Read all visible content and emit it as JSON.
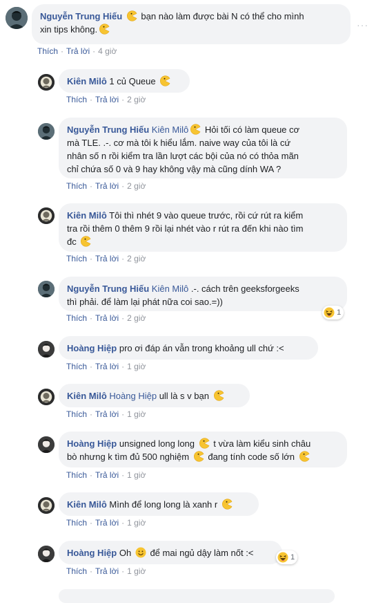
{
  "actions": {
    "like": "Thích",
    "reply": "Trả lời",
    "separator": "·"
  },
  "comments": [
    {
      "author": "Nguyễn Trung Hiếu",
      "text1": "bạn nào làm được bài N có thể cho mình",
      "text2": "xin tips không.",
      "time": "4 giờ",
      "avatar": "nth"
    },
    {
      "author": "Kiên Milô",
      "text": "1 củ Queue",
      "time": "2 giờ",
      "avatar": "km"
    },
    {
      "author": "Nguyễn Trung Hiếu",
      "tag": "Kiên Milô",
      "line1": "Hỏi tối có làm queue cơ",
      "line2": "mà TLE. .-. cơ mà tôi k hiểu lắm. naive way của tôi là cứ",
      "line3": "nhân số n rồi kiểm tra lần lượt các bội của nó có thỏa mãn",
      "line4": "chỉ chứa số 0 và 9 hay không vậy mà cũng dính WA ?",
      "time": "2 giờ",
      "avatar": "nth"
    },
    {
      "author": "Kiên Milô",
      "line1": "Tôi thì nhét 9 vào queue trước, rồi cứ rút ra kiểm",
      "line2": "tra rồi thêm 0 thêm 9 rồi lại nhét vào r rút ra đến khi nào tìm",
      "line3": "đc",
      "time": "2 giờ",
      "avatar": "km"
    },
    {
      "author": "Nguyễn Trung Hiếu",
      "tag": "Kiên Milô",
      "line1": ".-. cách trên geeksforgeeks",
      "line2": "thì phải. để làm lại phát nữa coi sao.=))",
      "time": "2 giờ",
      "reaction_count": "1",
      "avatar": "nth"
    },
    {
      "author": "Hoàng Hiệp",
      "text": "pro ơi đáp án vẫn trong khoảng ull chứ :<",
      "time": "1 giờ",
      "avatar": "hh"
    },
    {
      "author": "Kiên Milô",
      "tag": "Hoàng Hiệp",
      "text": "ull là s v bạn",
      "time": "1 giờ",
      "avatar": "km"
    },
    {
      "author": "Hoàng Hiệp",
      "line1a": "unsigned long long",
      "line1b": "t vừa làm kiểu sinh châu",
      "line2a": "bò nhưng k tìm đủ 500 nghiệm",
      "line2b": "đang tính code số lớn",
      "time": "1 giờ",
      "avatar": "hh"
    },
    {
      "author": "Kiên Milô",
      "text": "Mình để long long là xanh r",
      "time": "1 giờ",
      "avatar": "km"
    },
    {
      "author": "Hoàng Hiệp",
      "text_a": "Oh",
      "text_b": "để mai ngủ dậy làm nốt :<",
      "time": "1 giờ",
      "reaction_count": "1",
      "avatar": "hh"
    }
  ],
  "colors": {
    "bubble": "#f2f3f5",
    "link": "#385898",
    "meta": "#90949c",
    "emoji": "#f7c431"
  }
}
